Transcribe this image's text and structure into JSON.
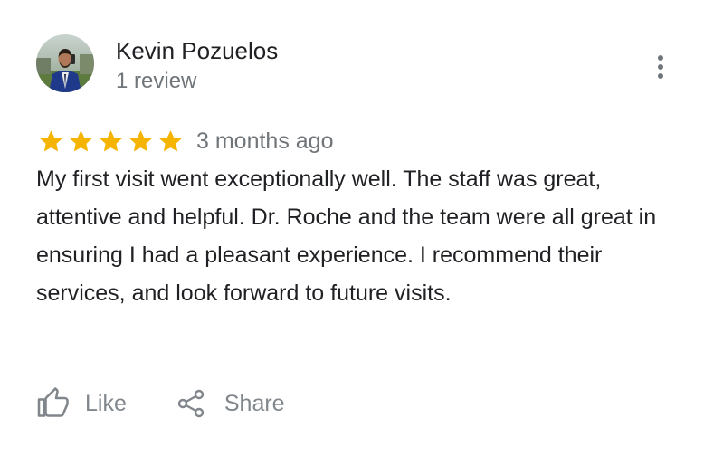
{
  "review": {
    "author": {
      "name": "Kevin Pozuelos",
      "review_count": "1 review",
      "avatar": "avatar-photo"
    },
    "rating": 5,
    "rating_max": 5,
    "star_color": "#f4b400",
    "time": "3 months ago",
    "text": "My first visit went exceptionally well. The staff was great, attentive and helpful. Dr. Roche and the team were all great in ensuring I had a pleasant experience. I recommend their services, and look forward to future visits.",
    "actions": {
      "like_label": "Like",
      "like_icon": "thumbs-up-icon",
      "share_label": "Share",
      "share_icon": "share-icon"
    },
    "menu_icon": "more-vert-icon"
  }
}
